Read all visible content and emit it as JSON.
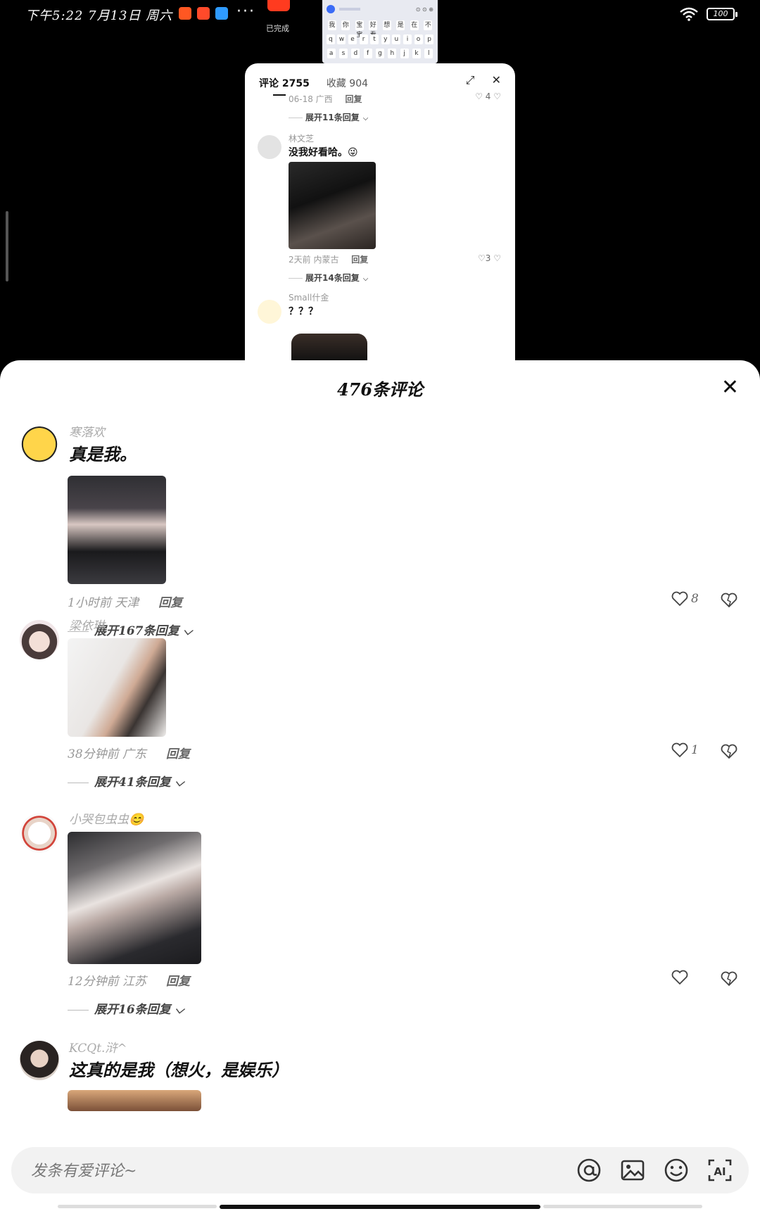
{
  "status_bar": {
    "time": "下午5:22 7月13日 周六",
    "more": "···",
    "battery": "100"
  },
  "done_window": {
    "label": "已完成"
  },
  "keyboard_preview": {
    "suggestions": [
      "我",
      "你",
      "宝宝",
      "好看",
      "想",
      "是",
      "在",
      "不"
    ],
    "row1": [
      "q",
      "w",
      "e",
      "r",
      "t",
      "y",
      "u",
      "i",
      "o",
      "p"
    ],
    "row2": [
      "a",
      "s",
      "d",
      "f",
      "g",
      "h",
      "j",
      "k",
      "l"
    ]
  },
  "background_panel": {
    "tabs": [
      {
        "label": "评论 2755"
      },
      {
        "label": "收藏 904"
      }
    ],
    "top_meta": "06-18 广西",
    "top_reply": "回复",
    "top_like_count": "4",
    "expand_1": "展开11条回复",
    "comment_1": {
      "name": "林文芝",
      "text": "没我好看哈。😜",
      "meta": "2天前 内蒙古",
      "reply": "回复",
      "like_count": "3",
      "expand": "展开14条回复"
    },
    "comment_2": {
      "name": "Small什金",
      "text": "？？？"
    }
  },
  "sheet": {
    "title": "476条评论",
    "comments": [
      {
        "name": "寒落欢",
        "text": "真是我。",
        "time_location": "1小时前 天津",
        "reply": "回复",
        "like_count": "8",
        "expand": "展开167条回复"
      },
      {
        "name": "梁依琳",
        "text": "",
        "time_location": "38分钟前 广东",
        "reply": "回复",
        "like_count": "1",
        "expand": "展开41条回复"
      },
      {
        "name": "小哭包虫虫😊",
        "text": "",
        "time_location": "12分钟前 江苏",
        "reply": "回复",
        "like_count": "",
        "expand": "展开16条回复"
      },
      {
        "name": "KCQt.浒^",
        "text": "这真的是我（想火，是娱乐）"
      }
    ]
  },
  "input_bar": {
    "placeholder": "发条有爱评论~",
    "icons": [
      "at-icon",
      "image-icon",
      "emoji-icon",
      "ai-icon"
    ]
  },
  "colors": {
    "sheet_bg": "#ffffff",
    "screen_bg": "#000000",
    "muted_text": "#999999"
  }
}
